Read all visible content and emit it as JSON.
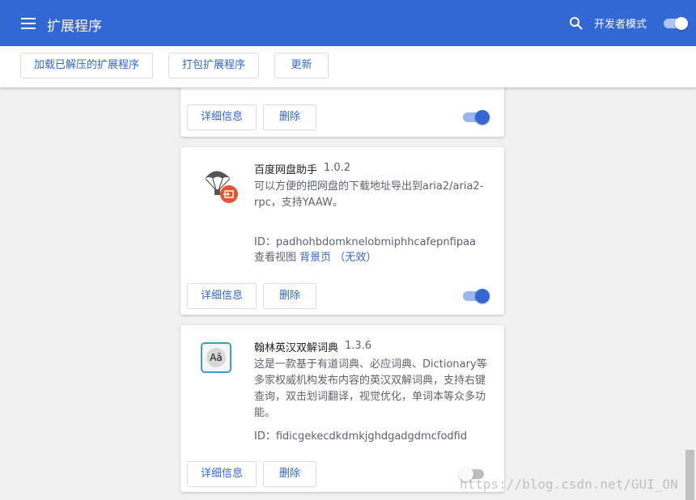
{
  "header": {
    "title": "扩展程序",
    "dev_mode_label": "开发者模式",
    "dev_mode_on": true
  },
  "toolbar": {
    "load_unpacked": "加载已解压的扩展程序",
    "pack": "打包扩展程序",
    "update": "更新"
  },
  "extensions": [
    {
      "details_label": "详细信息",
      "remove_label": "删除",
      "enabled": true
    },
    {
      "name": "百度网盘助手",
      "version": "1.0.2",
      "description": "可以方便的把网盘的下载地址导出到aria2/aria2-rpc，支持YAAW。",
      "id": "ID：padhohbdomknelobmiphhcafepnfipaa",
      "views_label": "查看视图",
      "views_link": "背景页",
      "views_status": "（无效）",
      "details_label": "详细信息",
      "remove_label": "删除",
      "enabled": true
    },
    {
      "name": "翰林英汉双解词典",
      "version": "1.3.6",
      "description": "这是一款基于有道词典、必应词典、Dictionary等多家权威机构发布内容的英汉双解词典，支持右键查询，双击划词翻译，视觉优化，单词本等众多功能。",
      "icon_text": "Aā",
      "id": "ID：fidicgekecdkdmkjghdgadgdmcfodfid",
      "details_label": "详细信息",
      "remove_label": "删除",
      "enabled": false
    }
  ],
  "watermark": "https://blog.csdn.net/GUI_ON"
}
